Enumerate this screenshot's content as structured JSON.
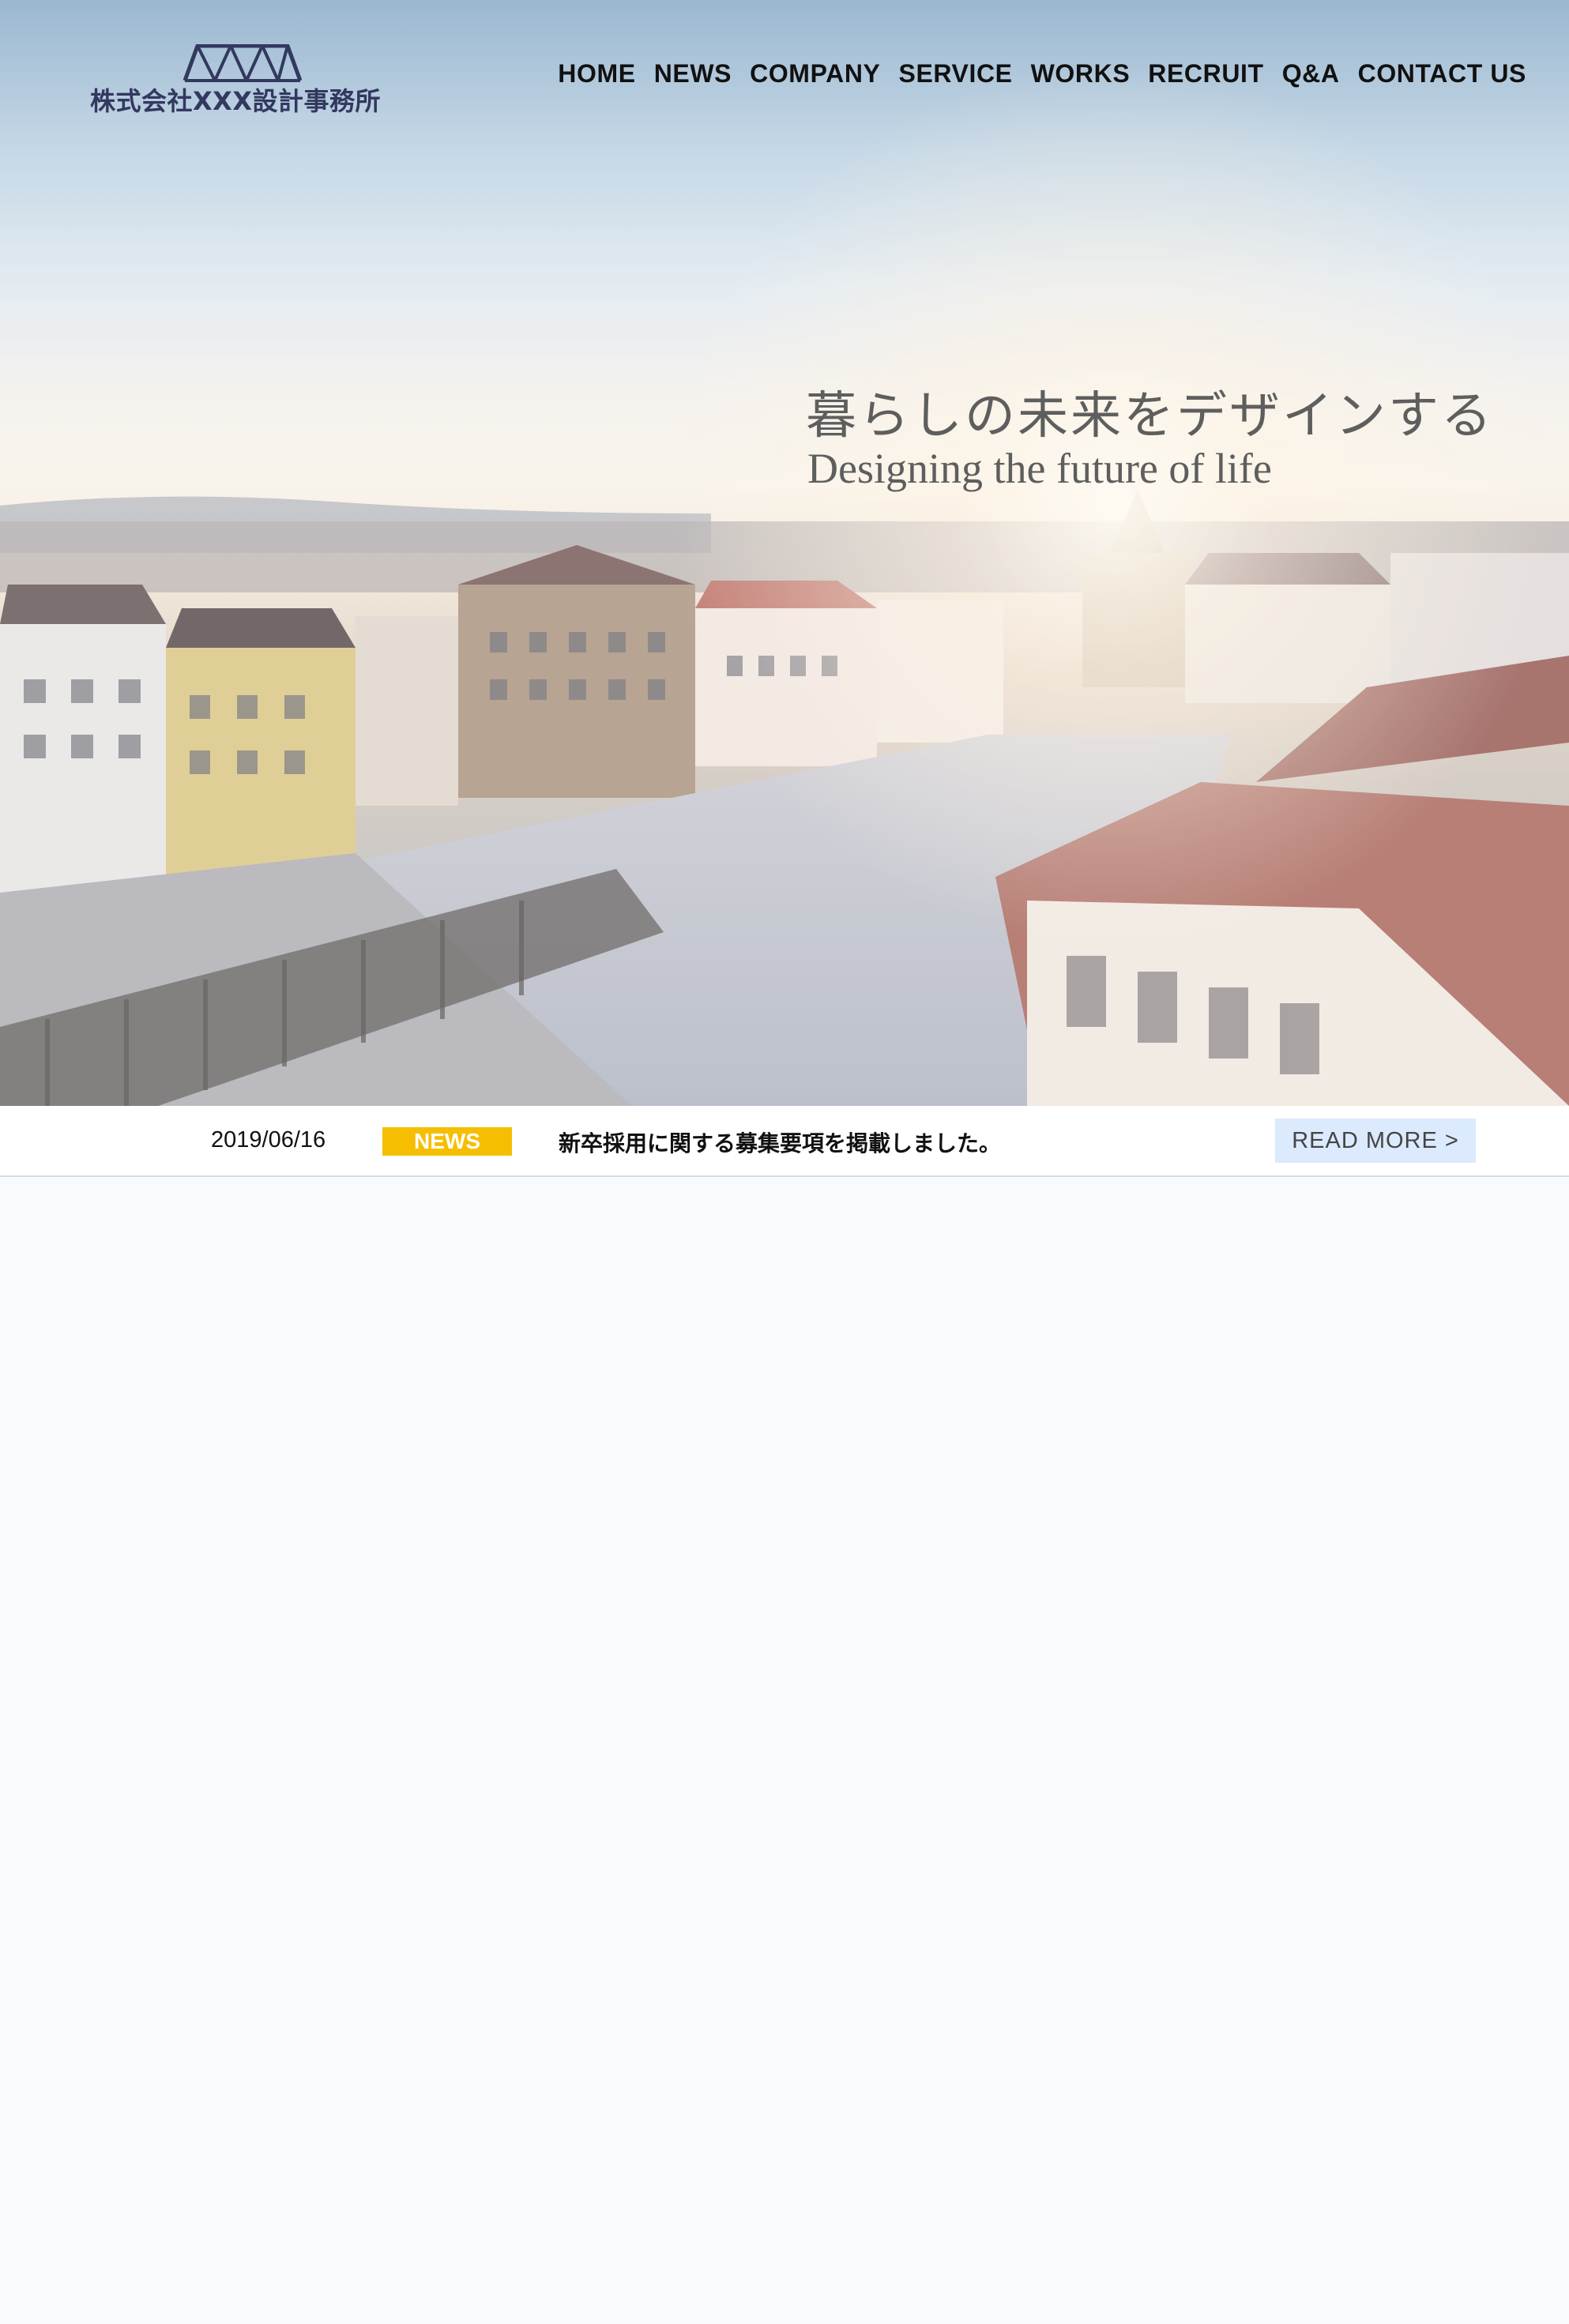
{
  "brand": {
    "name": "株式会社XXX設計事務所",
    "logo_icon": "roof-truss-logo"
  },
  "nav": {
    "items": [
      "HOME",
      "NEWS",
      "COMPANY",
      "SERVICE",
      "WORKS",
      "RECRUIT",
      "Q&A",
      "CONTACT US"
    ]
  },
  "hero": {
    "tagline_jp": "暮らしの未来をデザインする",
    "tagline_en": "Designing the future of life",
    "image": "aerial-town-square-at-sunset"
  },
  "news": {
    "date": "2019/06/16",
    "badge": "NEWS",
    "title": "新卒採用に関する募集要項を掲載しました。",
    "read_more": "READ MORE >"
  },
  "colors": {
    "logo": "#33385f",
    "badge": "#f6be00",
    "read_more_bg": "#dbeafd",
    "page_bg": "#f8fbfd"
  }
}
